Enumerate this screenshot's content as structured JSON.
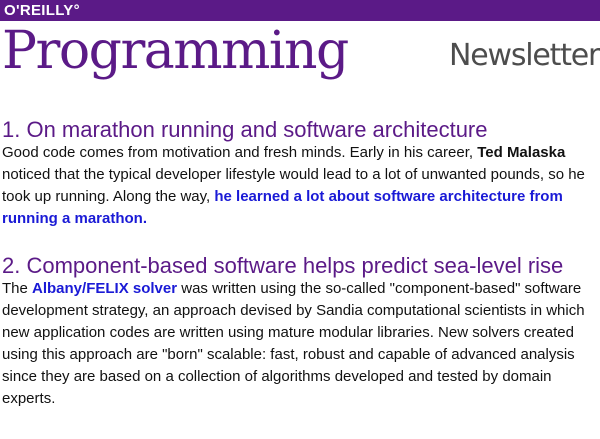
{
  "header": {
    "brand": "O'REILLY°",
    "title": "Programming",
    "subtitle": "Newsletter"
  },
  "colors": {
    "brand_purple": "#5b1a87",
    "link_blue": "#1a1ad6",
    "subtitle_gray": "#4d4d4d"
  },
  "articles": [
    {
      "headline": "1. On marathon running and software architecture",
      "text_1": "Good code comes from motivation and fresh minds. Early in his career, ",
      "bold_1": "Ted Malaska",
      "text_2": " noticed that the typical developer lifestyle would lead to a lot of unwanted pounds, so he took up running. Along the way, ",
      "link": "he learned a lot about software architecture from running a marathon.",
      "text_3": ""
    },
    {
      "headline": "2. Component-based software helps predict sea-level rise",
      "text_1": "The ",
      "link": "Albany/FELIX solver",
      "text_2": " was written using the so-called \"component-based\" software development strategy, an approach devised by Sandia computational scientists in which new application codes are written using mature modular libraries. New solvers created using this approach are \"born\" scalable: fast, robust and capable of advanced analysis since they are based on a collection of algorithms developed and tested by domain experts."
    }
  ]
}
